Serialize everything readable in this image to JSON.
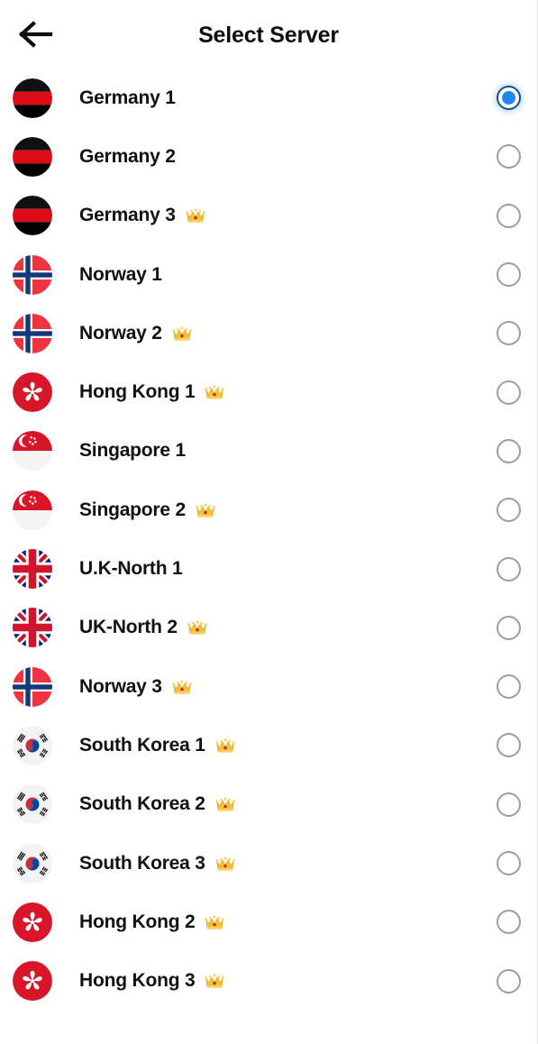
{
  "header": {
    "title": "Select Server",
    "back_icon": "arrow-left-icon"
  },
  "premium_icon": "crown-icon",
  "colors": {
    "background": "#ffffff",
    "text": "#111111",
    "radio_unselected_border": "#9e9e9e",
    "radio_selected_ring": "#1c4f80",
    "radio_selected_dot": "#1e88ef",
    "crown_gold": "#f5c242"
  },
  "servers": [
    {
      "label": "Germany 1",
      "flag": "de",
      "premium": false,
      "selected": true
    },
    {
      "label": "Germany 2",
      "flag": "de",
      "premium": false,
      "selected": false
    },
    {
      "label": "Germany 3",
      "flag": "de",
      "premium": true,
      "selected": false
    },
    {
      "label": "Norway 1",
      "flag": "no",
      "premium": false,
      "selected": false
    },
    {
      "label": "Norway 2",
      "flag": "no",
      "premium": true,
      "selected": false
    },
    {
      "label": "Hong Kong 1",
      "flag": "hk",
      "premium": true,
      "selected": false
    },
    {
      "label": "Singapore 1",
      "flag": "sg",
      "premium": false,
      "selected": false
    },
    {
      "label": "Singapore 2",
      "flag": "sg",
      "premium": true,
      "selected": false
    },
    {
      "label": "U.K-North 1",
      "flag": "gb",
      "premium": false,
      "selected": false
    },
    {
      "label": "UK-North 2",
      "flag": "gb",
      "premium": true,
      "selected": false
    },
    {
      "label": "Norway 3",
      "flag": "no",
      "premium": true,
      "selected": false
    },
    {
      "label": "South Korea 1",
      "flag": "kr",
      "premium": true,
      "selected": false
    },
    {
      "label": "South Korea 2",
      "flag": "kr",
      "premium": true,
      "selected": false
    },
    {
      "label": "South Korea 3",
      "flag": "kr",
      "premium": true,
      "selected": false
    },
    {
      "label": "Hong Kong 2",
      "flag": "hk",
      "premium": true,
      "selected": false
    },
    {
      "label": "Hong Kong 3",
      "flag": "hk",
      "premium": true,
      "selected": false
    }
  ]
}
